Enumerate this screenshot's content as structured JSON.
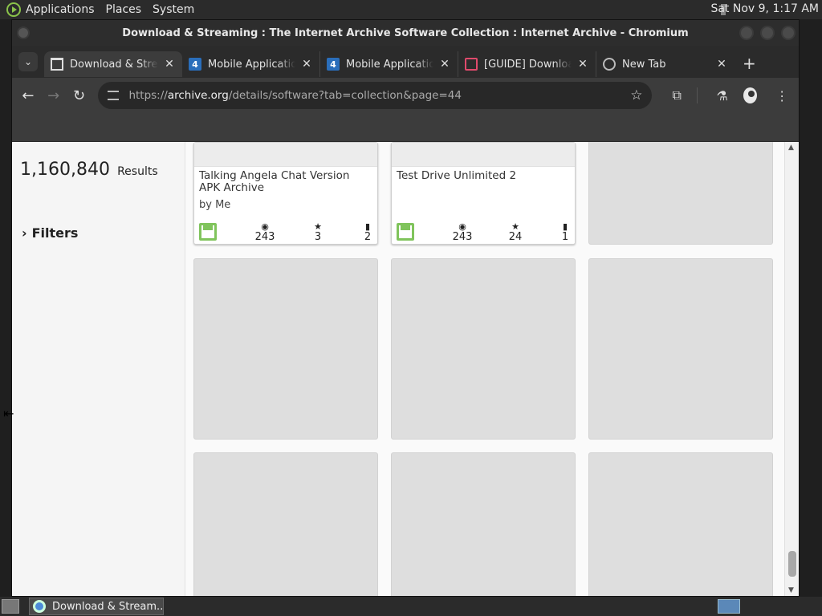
{
  "panel": {
    "menus": [
      "Applications",
      "Places",
      "System"
    ],
    "clock": "Sat Nov  9,  1:17 AM"
  },
  "window": {
    "title": "Download & Streaming : The Internet Archive Software Collection : Internet Archive - Chromium"
  },
  "tabs": [
    {
      "title": "Download & Streaming",
      "icon": "internet-archive-icon",
      "active": true
    },
    {
      "title": "Mobile Application",
      "icon": "site-4-icon",
      "active": false
    },
    {
      "title": "Mobile Application",
      "icon": "site-4-icon",
      "active": false
    },
    {
      "title": "[GUIDE] Download",
      "icon": "guide-icon",
      "active": false
    },
    {
      "title": "New Tab",
      "icon": "globe-icon",
      "active": false
    }
  ],
  "toolbar": {
    "url_prefix": "https://",
    "url_host": "archive.org",
    "url_path": "/details/software?tab=collection&page=44"
  },
  "sidebar": {
    "results_count": "1,160,840",
    "results_label": "Results",
    "filters_label": "Filters"
  },
  "cards": [
    {
      "title": "Talking Angela Chat Version APK Archive",
      "byline": "by Me",
      "views": "243",
      "favorites": "3",
      "reviews": "2"
    },
    {
      "title": "Test Drive Unlimited 2",
      "byline": "",
      "views": "243",
      "favorites": "24",
      "reviews": "1"
    }
  ],
  "taskbar": {
    "task_label": "Download & Stream..."
  }
}
